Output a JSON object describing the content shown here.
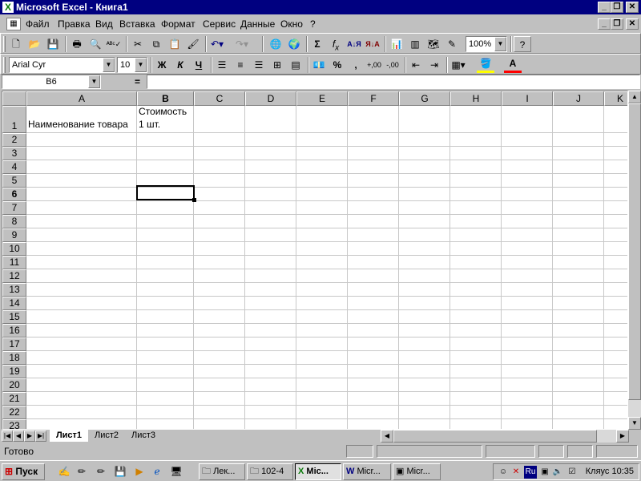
{
  "window": {
    "title": "Microsoft Excel - Книга1",
    "icon": "excel-icon"
  },
  "menu": [
    "Файл",
    "Правка",
    "Вид",
    "Вставка",
    "Формат",
    "Сервис",
    "Данные",
    "Окно",
    "?"
  ],
  "toolbar": {
    "zoom": "100%"
  },
  "formatting": {
    "font": "Arial Cyr",
    "size": "10",
    "bold": "Ж",
    "italic": "К",
    "underline": "Ч",
    "percent": "%",
    "comma": ","
  },
  "formula": {
    "namebox": "B6",
    "eq": "=",
    "value": ""
  },
  "columns": [
    "A",
    "B",
    "C",
    "D",
    "E",
    "F",
    "G",
    "H",
    "I",
    "J",
    "K"
  ],
  "rows": [
    "1",
    "2",
    "3",
    "4",
    "5",
    "6",
    "7",
    "8",
    "9",
    "10",
    "11",
    "12",
    "13",
    "14",
    "15",
    "16",
    "17",
    "18",
    "19",
    "20",
    "21",
    "22",
    "23"
  ],
  "cells": {
    "A1": "Наименование товара",
    "B1_line1": "Стоимость",
    "B1_line2": "1 шт."
  },
  "sheets": [
    "Лист1",
    "Лист2",
    "Лист3"
  ],
  "status": {
    "text": "Готово"
  },
  "taskbar": {
    "start": "Пуск",
    "tasks": [
      "Лек...",
      "102-4",
      "Mic...",
      "Micr...",
      "Micr..."
    ],
    "clock": "Кляус 10:35",
    "lang": "Ru"
  }
}
